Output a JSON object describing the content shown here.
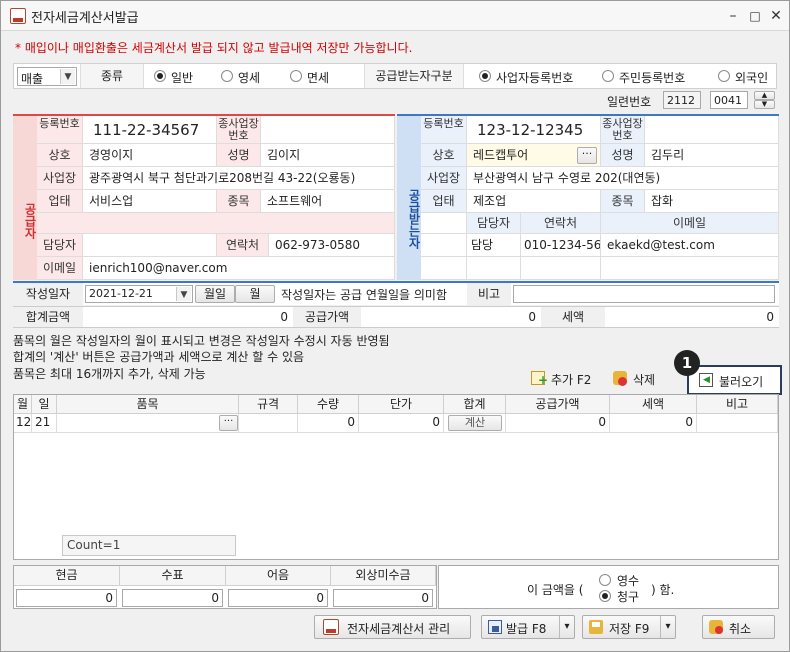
{
  "window": {
    "title": "전자세금계산서발급",
    "minimize": "–",
    "maximize": "□",
    "close": "✕"
  },
  "notice": "* 매입이나 매입환출은 세금계산서 발급 되지 않고 발급내역 저장만 가능합니다.",
  "type_row": {
    "trade_select": "매출",
    "kind_label": "종류",
    "kinds": [
      "일반",
      "영세",
      "면세"
    ],
    "recipient_type_label": "공급받는자구분",
    "recipient_types": [
      "사업자등록번호",
      "주민등록번호",
      "외국인"
    ]
  },
  "serial": {
    "label": "일련번호",
    "year": "2112",
    "seq": "0041",
    "up": "▲",
    "down": "▼"
  },
  "supplier": {
    "side_label": "공급자",
    "reg_label": "등록번호",
    "reg_no": "111-22-34567",
    "branch_label": "종사업장번호",
    "branch_no": "",
    "company_label": "상호",
    "company": "경영이지",
    "ceo_label": "성명",
    "ceo": "김이지",
    "address_label": "사업장",
    "address": "광주광역시 북구 첨단과기로208번길 43-22(오룡동)",
    "biz_type_label": "업태",
    "biz_type": "서비스업",
    "item_label": "종목",
    "item": "소프트웨어",
    "manager_label": "담당자",
    "manager": "",
    "contact_label": "연락처",
    "contact": "062-973-0580",
    "email_label": "이메일",
    "email": "ienrich100@naver.com"
  },
  "buyer": {
    "side_label": "공급받는자",
    "reg_label": "등록번호",
    "reg_no": "123-12-12345",
    "branch_label": "종사업장번호",
    "branch_no": "",
    "company_label": "상호",
    "company": "레드캡투어",
    "lookup": "···",
    "ceo_label": "성명",
    "ceo": "김두리",
    "address_label": "사업장",
    "address": "부산광역시 남구 수영로 202(대연동)",
    "biz_type_label": "업태",
    "biz_type": "제조업",
    "item_label": "종목",
    "item": "잡화",
    "contacts_header": [
      "담당자",
      "연락처",
      "이메일"
    ],
    "contacts": [
      {
        "name": "담당",
        "phone": "010-1234-5678",
        "email": "ekaekd@test.com"
      }
    ]
  },
  "date_row": {
    "label": "작성일자",
    "date": "2021-12-21",
    "month_day_btn": "월일",
    "month_btn": "월",
    "hint": "작성일자는 공급 연월일을 의미함",
    "note_label": "비고",
    "note": ""
  },
  "totals": {
    "total_label": "합계금액",
    "total": "0",
    "supply_label": "공급가액",
    "supply": "0",
    "tax_label": "세액",
    "tax": "0"
  },
  "info_lines": [
    "품목의 월은 작성일자의 월이 표시되고 변경은 작성일자 수정시 자동 반영됨",
    "합계의 '계산' 버튼은 공급가액과 세액으로 계산 할 수 있음",
    "품목은 최대 16개까지 추가, 삭제 가능"
  ],
  "item_actions": {
    "add": "추가 F2",
    "delete": "삭제",
    "load": "불러오기",
    "badge": "1"
  },
  "grid": {
    "headers": [
      "월",
      "일",
      "품목",
      "규격",
      "수량",
      "단가",
      "합계",
      "공급가액",
      "세액",
      "비고"
    ],
    "rows": [
      {
        "month": "12",
        "day": "21",
        "item": "",
        "ellipsis": "···",
        "spec": "",
        "qty": "0",
        "price": "0",
        "calc": "계산",
        "supply": "0",
        "tax": "0",
        "note": ""
      }
    ],
    "count": "Count=1"
  },
  "payment": {
    "headers": [
      "현금",
      "수표",
      "어음",
      "외상미수금"
    ],
    "values": [
      "0",
      "0",
      "0",
      "0"
    ],
    "amount_prefix": "이 금액을 (",
    "options": [
      "영수",
      "청구"
    ],
    "amount_suffix": ") 함."
  },
  "footer": {
    "manage": "전자세금계산서 관리",
    "issue": "발급 F8",
    "save": "저장 F9",
    "cancel": "취소",
    "dropdown": "▾"
  },
  "colors": {
    "supplier": "#e04848",
    "buyer": "#3b78c8",
    "notice": "#d40000",
    "badge": "#222222"
  }
}
